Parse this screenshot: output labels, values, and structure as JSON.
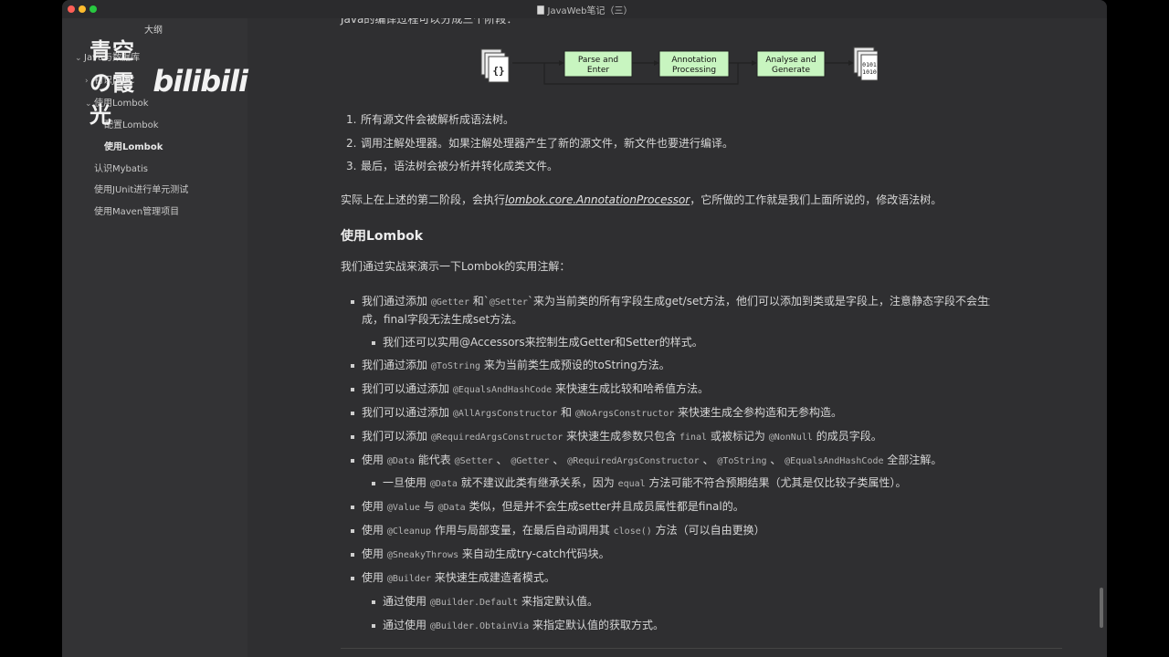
{
  "window": {
    "title": "JavaWeb笔记（三）"
  },
  "watermark": {
    "name": "青空の霞光",
    "logo": "bilibili"
  },
  "sidebar": {
    "outline_label": "大纲",
    "items": [
      {
        "label": "Java与数据库"
      },
      {
        "label": "初识JDBC"
      },
      {
        "label": "使用Lombok"
      },
      {
        "label": "配置Lombok"
      },
      {
        "label": "使用Lombok"
      },
      {
        "label": "认识Mybatis"
      },
      {
        "label": "使用JUnit进行单元测试"
      },
      {
        "label": "使用Maven管理项目"
      }
    ]
  },
  "content": {
    "cut_line": "Java的编译过程可以分成三个阶段：",
    "diagram": {
      "src_glyph": "{}",
      "box1": [
        "Parse and",
        "Enter"
      ],
      "box2": [
        "Annotation",
        "Processing"
      ],
      "box3": [
        "Analyse and",
        "Generate"
      ],
      "bin_glyph": [
        "0101",
        "1010"
      ]
    },
    "ol": [
      {
        "n": "1.",
        "text": "所有源文件会被解析成语法树。"
      },
      {
        "n": "2.",
        "text": "调用注解处理器。如果注解处理器产生了新的源文件，新文件也要进行编译。"
      },
      {
        "n": "3.",
        "text": "最后，语法树会被分析并转化成类文件。"
      }
    ],
    "para1": {
      "a": "实际上在上述的第二阶段，会执行",
      "b": "lombok.core.AnnotationProcessor",
      "c": "，它所做的工作就是我们上面所说的，修改语法树。"
    },
    "heading": "使用Lombok",
    "para2": "我们通过实战来演示一下Lombok的实用注解：",
    "bullets": {
      "b1": {
        "a": "我们通过添加 ",
        "c1": "@Getter",
        "b": " 和`",
        "c2": "@Setter",
        "c": "`来为当前类的所有字段生成get/set方法，他们可以添加到类或是字段上，注意静态字段不会生"
      },
      "b1_cont": "成，final字段无法生成set方法。",
      "b1_sub": "我们还可以实用@Accessors来控制生成Getter和Setter的样式。",
      "b2": {
        "a": "我们通过添加 ",
        "c1": "@ToString",
        "b": " 来为当前类生成预设的toString方法。"
      },
      "b3": {
        "a": "我们可以通过添加 ",
        "c1": "@EqualsAndHashCode",
        "b": " 来快速生成比较和哈希值方法。"
      },
      "b4": {
        "a": "我们可以通过添加 ",
        "c1": "@AllArgsConstructor",
        "b": " 和 ",
        "c2": "@NoArgsConstructor",
        "c": " 来快速生成全参构造和无参构造。"
      },
      "b5": {
        "a": "我们可以添加 ",
        "c1": "@RequiredArgsConstructor",
        "b": " 来快速生成参数只包含 ",
        "c2": "final",
        "c": " 或被标记为 ",
        "c3": "@NonNull",
        "d": " 的成员字段。"
      },
      "b6": {
        "a": "使用 ",
        "c1": "@Data",
        "b": " 能代表 ",
        "c2": "@Setter",
        "s1": " 、 ",
        "c3": "@Getter",
        "s2": " 、 ",
        "c4": "@RequiredArgsConstructor",
        "s3": " 、 ",
        "c5": "@ToString",
        "s4": " 、 ",
        "c6": "@EqualsAndHashCode",
        "d": " 全部注解。"
      },
      "b6_sub": {
        "a": "一旦使用 ",
        "c1": "@Data",
        "b": " 就不建议此类有继承关系，因为 ",
        "c2": "equal",
        "c": " 方法可能不符合预期结果（尤其是仅比较子类属性）。"
      },
      "b7": {
        "a": "使用 ",
        "c1": "@Value",
        "b": " 与 ",
        "c2": "@Data",
        "c": " 类似，但是并不会生成setter并且成员属性都是final的。"
      },
      "b8": {
        "a": "使用 ",
        "c1": "@Cleanup",
        "b": " 作用与局部变量，在最后自动调用其 ",
        "c2": "close()",
        "c": " 方法（可以自由更换）"
      },
      "b9": {
        "a": "使用 ",
        "c1": "@SneakyThrows",
        "b": " 来自动生成try-catch代码块。"
      },
      "b10": {
        "a": "使用 ",
        "c1": "@Builder",
        "b": " 来快速生成建造者模式。"
      },
      "b10_sub1": {
        "a": "通过使用 ",
        "c1": "@Builder.Default",
        "b": " 来指定默认值。"
      },
      "b10_sub2": {
        "a": "通过使用 ",
        "c1": "@Builder.ObtainVia",
        "b": " 来指定默认值的获取方式。"
      }
    }
  }
}
